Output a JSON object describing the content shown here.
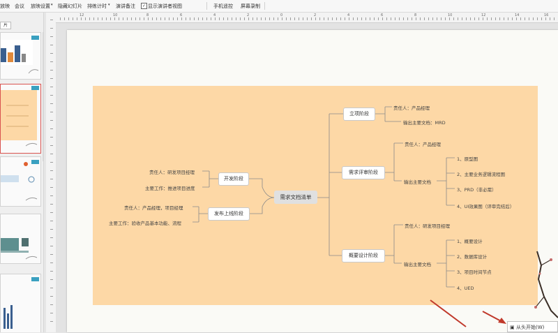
{
  "toolbar": {
    "items": [
      "放映",
      "会议",
      "放映设置",
      "隐藏幻灯片",
      "排练计时",
      "演讲备注",
      "显示演讲者视图",
      "手机遥控",
      "屏幕录制"
    ]
  },
  "left_panel": {
    "tab_label": "片"
  },
  "ruler": {
    "h_labels": [
      "12",
      "10",
      "8",
      "6",
      "4",
      "2",
      "0",
      "2",
      "4",
      "6",
      "8",
      "10",
      "12",
      "14",
      "16"
    ]
  },
  "mindmap": {
    "center": "需求文档清单",
    "left": [
      {
        "node": "开发阶段",
        "leaves": [
          "责任人：研发项目经理",
          "主要工作：推进项目进度"
        ]
      },
      {
        "node": "发布上线阶段",
        "leaves": [
          "责任人：产品经理，项目经理",
          "主要工作：验收产品基本功能、流程"
        ]
      }
    ],
    "right": [
      {
        "node": "立项阶段",
        "leaves": [
          "责任人：产品经理",
          "输出主要文档：MRD"
        ]
      },
      {
        "node": "需求评审阶段",
        "leaves": [
          "责任人：产品经理",
          "输出主要文档"
        ],
        "sub": [
          "1、原型图",
          "2、主要业务逻辑流程图",
          "3、PRD（非必需）",
          "4、UI效果图（评审完结后）"
        ]
      },
      {
        "node": "概要设计阶段",
        "leaves": [
          "责任人：研发项目经理",
          "输出主要文档"
        ],
        "sub": [
          "1、概要设计",
          "2、数据库设计",
          "3、项目时间节点",
          "4、UED"
        ]
      }
    ]
  },
  "play_button": "从头开始(W)",
  "colors": {
    "mind_bg": "#fdd8a6",
    "accent": "#c0392b"
  }
}
